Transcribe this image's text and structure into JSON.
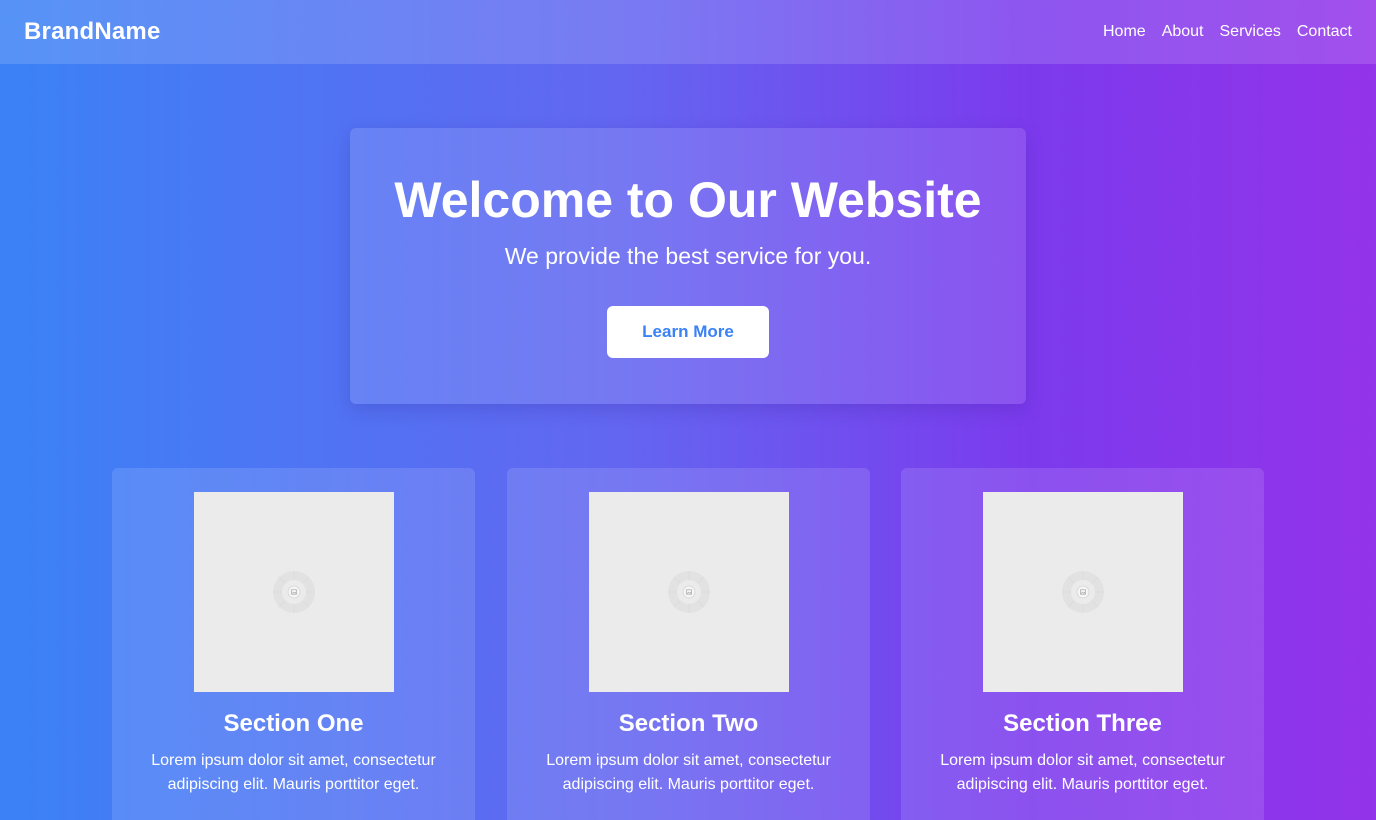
{
  "navbar": {
    "brand": "BrandName",
    "links": [
      "Home",
      "About",
      "Services",
      "Contact"
    ]
  },
  "hero": {
    "title": "Welcome to Our Website",
    "subtitle": "We provide the best service for you.",
    "button_label": "Learn More"
  },
  "sections": [
    {
      "title": "Section One",
      "text": "Lorem ipsum dolor sit amet, consectetur adipiscing elit. Mauris porttitor eget.",
      "image_icon": "image-placeholder-icon"
    },
    {
      "title": "Section Two",
      "text": "Lorem ipsum dolor sit amet, consectetur adipiscing elit. Mauris porttitor eget.",
      "image_icon": "image-placeholder-icon"
    },
    {
      "title": "Section Three",
      "text": "Lorem ipsum dolor sit amet, consectetur adipiscing elit. Mauris porttitor eget.",
      "image_icon": "image-placeholder-icon"
    }
  ],
  "colors": {
    "gradient_start": "#3b82f6",
    "gradient_end": "#9333ea",
    "button_text": "#3b82f6",
    "image_placeholder": "#ebebeb"
  }
}
